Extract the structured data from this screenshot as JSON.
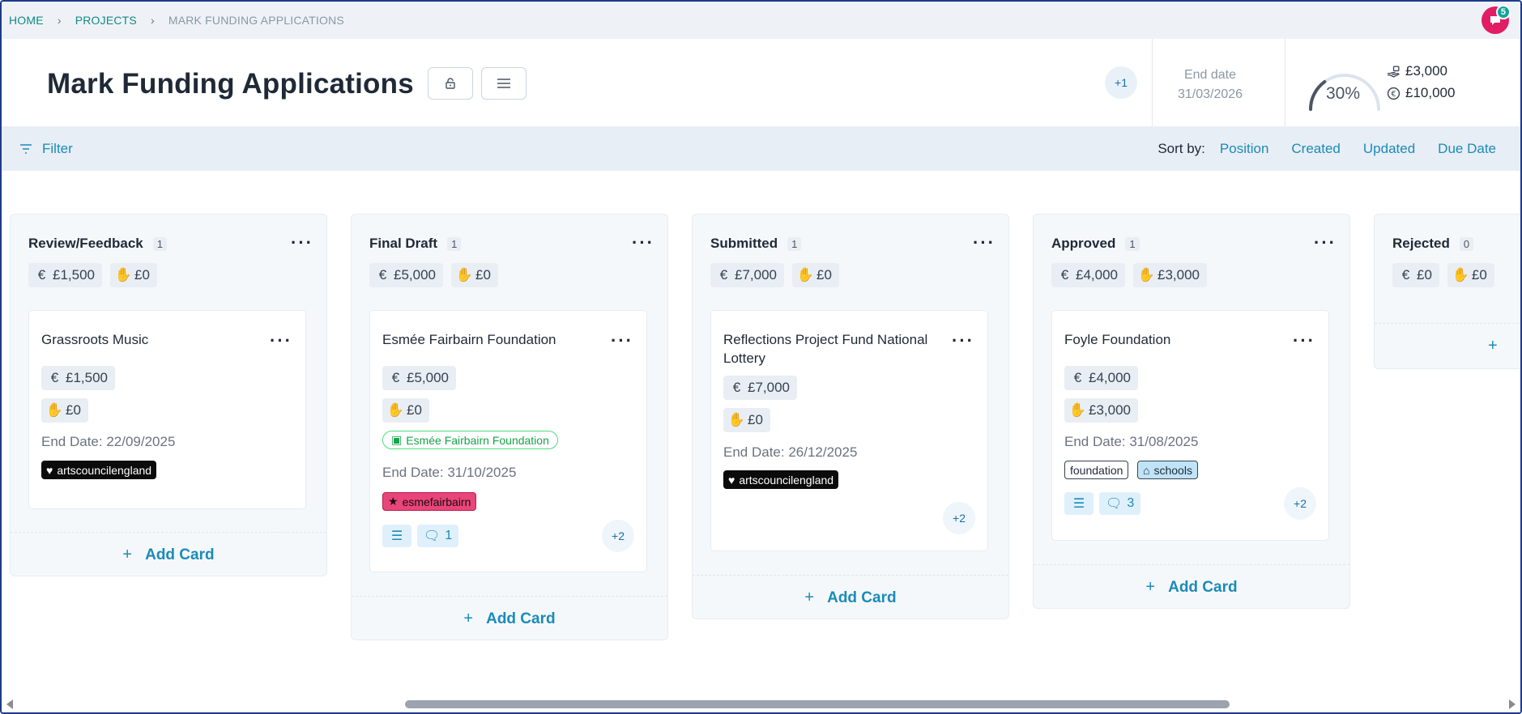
{
  "breadcrumb": {
    "home": "HOME",
    "projects": "PROJECTS",
    "current": "MARK FUNDING APPLICATIONS"
  },
  "notifications": {
    "count": "5",
    "icon": "chat-bubble-icon",
    "color": "#e11d64"
  },
  "header": {
    "title": "Mark Funding Applications",
    "extra_members": "+1",
    "end_date_label": "End date",
    "end_date_value": "31/03/2026",
    "progress_label": "30%",
    "progress_fraction": 0.3,
    "raised_amount": "£3,000",
    "target_amount": "£10,000"
  },
  "filterbar": {
    "filter_label": "Filter",
    "sort_label": "Sort by:",
    "sort_options": [
      "Position",
      "Created",
      "Updated",
      "Due Date"
    ]
  },
  "columns": [
    {
      "title": "Review/Feedback",
      "count": "1",
      "requested": "£1,500",
      "awarded": "£0",
      "add_label": "Add Card",
      "card": {
        "title": "Grassroots Music",
        "requested": "£1,500",
        "awarded": "£0",
        "end_date": "End Date: 22/09/2025",
        "tags": [
          "artscouncilengland"
        ]
      }
    },
    {
      "title": "Final Draft",
      "count": "1",
      "requested": "£5,000",
      "awarded": "£0",
      "add_label": "Add Card",
      "card": {
        "title": "Esmée Fairbairn Foundation",
        "requested": "£5,000",
        "awarded": "£0",
        "funder": "Esmée Fairbairn Foundation",
        "end_date": "End Date: 31/10/2025",
        "tags": [
          "esmefairbairn"
        ],
        "comments": "1",
        "extra": "+2"
      }
    },
    {
      "title": "Submitted",
      "count": "1",
      "requested": "£7,000",
      "awarded": "£0",
      "add_label": "Add Card",
      "card": {
        "title": "Reflections Project Fund National Lottery",
        "requested": "£7,000",
        "awarded": "£0",
        "end_date": "End Date: 26/12/2025",
        "tags": [
          "artscouncilengland"
        ],
        "extra": "+2"
      }
    },
    {
      "title": "Approved",
      "count": "1",
      "requested": "£4,000",
      "awarded": "£3,000",
      "add_label": "Add Card",
      "card": {
        "title": "Foyle Foundation",
        "requested": "£4,000",
        "awarded": "£3,000",
        "end_date": "End Date: 31/08/2025",
        "tags": [
          "foundation",
          "schools"
        ],
        "comments": "3",
        "extra": "+2"
      }
    },
    {
      "title": "Rejected",
      "count": "0",
      "requested": "£0",
      "awarded": "£0"
    }
  ],
  "colors": {
    "accent": "#1b8bb8",
    "teal": "#128a84",
    "pink_tag": "#e8457a"
  }
}
